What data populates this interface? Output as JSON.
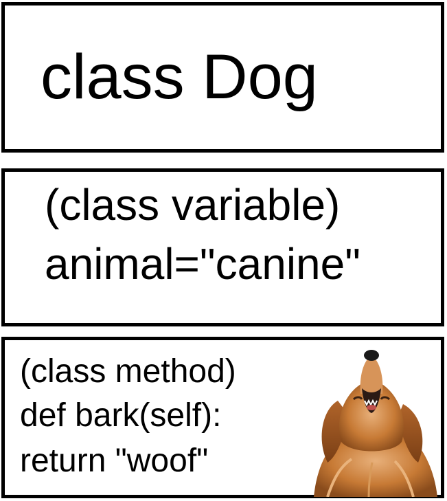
{
  "title_box": {
    "text": "class Dog"
  },
  "variable_box": {
    "line1": "(class variable)",
    "line2": "animal=\"canine\""
  },
  "method_box": {
    "line1": "(class method)",
    "line2": "def bark(self):",
    "line3": "return \"woof\"",
    "image_icon": "barking-dog-icon"
  },
  "colors": {
    "border": "#000000",
    "background": "#ffffff",
    "dog_fur": "#c77a35",
    "dog_fur_light": "#e8b07a"
  }
}
